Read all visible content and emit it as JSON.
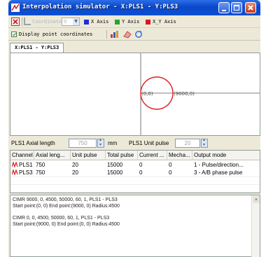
{
  "window": {
    "title": "Interpolation simulator - X:PLS1 - Y:PLS3",
    "tab_label": "X:PLS1 - Y:PLS3"
  },
  "toolbar": {
    "coordinate_label": "Coordinate",
    "coordinate_value": "0",
    "x_axis_label": "X Axis",
    "y_axis_label": "Y Axis",
    "xy_axis_label": "X_Y Axis",
    "display_coords_label": "Display point coordinates",
    "colors": {
      "x_axis": "#1f2fd0",
      "y_axis": "#2aa52a",
      "xy_axis": "#d81a1a"
    }
  },
  "plot": {
    "start_label": "(0,0)",
    "end_label": "(9000,0)",
    "circle_color": "#e21b1b",
    "axis_color": "#555555"
  },
  "params": {
    "axial_length_label": "PLS1 Axial length",
    "axial_length_value": "750",
    "axial_length_unit": "mm",
    "unit_pulse_label": "PLS1 Unit pulse",
    "unit_pulse_value": "20"
  },
  "grid": {
    "columns": [
      "Channel",
      "Axial leng...",
      "Unit pulse",
      "Total pulse",
      "Current ...",
      "Mecha...",
      "Output mode"
    ],
    "rows": [
      [
        "PLS1",
        "750",
        "20",
        "15000",
        "0",
        "0",
        "1 - Pulse/direction..."
      ],
      [
        "PLS3",
        "750",
        "20",
        "15000",
        "0",
        "0",
        "3 - A/B phase pulse"
      ]
    ]
  },
  "log": {
    "lines": [
      "CIMR 9000, 0, 4500, 50000, 60, 1, PLS1 - PLS3",
      "Start point:(0, 0)    End point:(9000, 0)    Radius:4500",
      "CIMR 0, 0, 4500, 50000, 60, 1, PLS1 - PLS3",
      "Start point:(9000, 0)    End point:(0, 0)    Radius:4500"
    ]
  }
}
